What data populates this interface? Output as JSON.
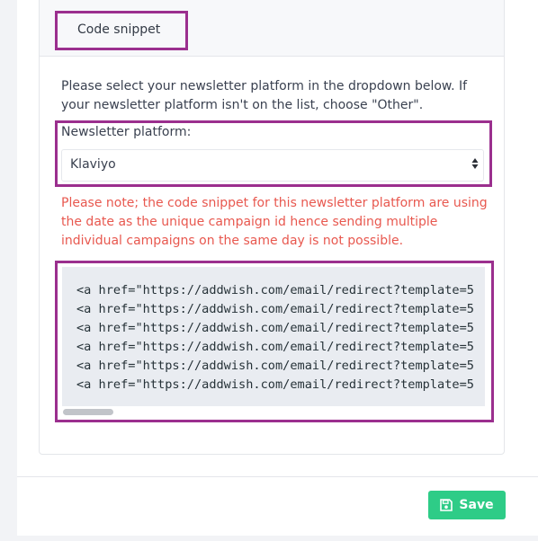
{
  "header": {
    "tab_label": "Code snippet"
  },
  "instructions": "Please select your newsletter platform in the dropdown below. If your newsletter platform isn't on the list, choose \"Other\".",
  "platform": {
    "label": "Newsletter platform:",
    "selected": "Klaviyo"
  },
  "note": "Please note; the code snippet for this newsletter platform are using the date as the unique campaign id hence sending multiple individual campaigns on the same day is not possible.",
  "code_lines": [
    "<a href=\"https://addwish.com/email/redirect?template=5",
    "<a href=\"https://addwish.com/email/redirect?template=5",
    "<a href=\"https://addwish.com/email/redirect?template=5",
    "<a href=\"https://addwish.com/email/redirect?template=5",
    "<a href=\"https://addwish.com/email/redirect?template=5",
    "<a href=\"https://addwish.com/email/redirect?template=5"
  ],
  "footer": {
    "save_label": "Save"
  },
  "colors": {
    "highlight": "#9b2f8e",
    "warning": "#e8584f",
    "save": "#2ecc87"
  },
  "icons": {
    "save": "floppy-disk-icon",
    "select": "sort-caret-icon"
  }
}
